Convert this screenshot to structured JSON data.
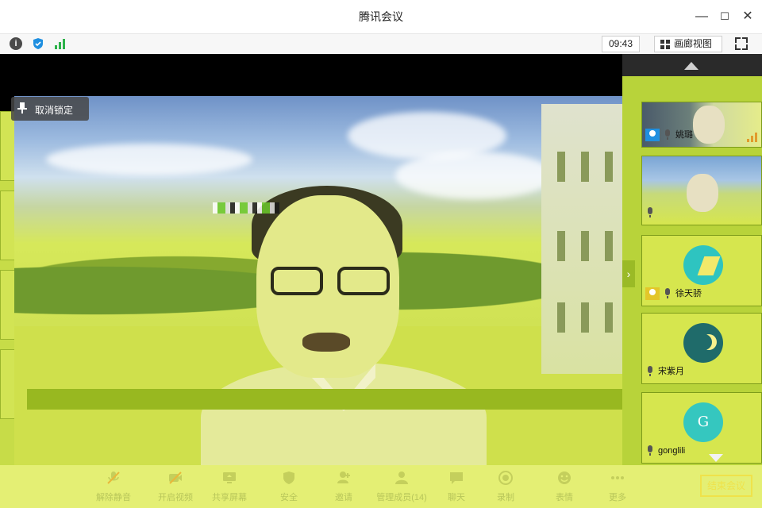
{
  "window": {
    "title": "腾讯会议",
    "minimize_glyph": "—",
    "maximize_glyph": "☐",
    "close_glyph": "✕"
  },
  "toolbar": {
    "info_icon": "info-icon",
    "info_glyph": "i",
    "shield_icon": "shield-icon",
    "signal_icon": "signal-icon",
    "time": "09:43",
    "gallery_label": "画廊视图",
    "fullscreen_icon": "fullscreen-icon"
  },
  "main_video": {
    "unlock_label": "取消锁定"
  },
  "participants": [
    {
      "name": "姚璐",
      "type": "video"
    },
    {
      "name": "",
      "type": "video"
    },
    {
      "name": "徐天骄",
      "type": "avatar"
    },
    {
      "name": "宋紫月",
      "type": "avatar"
    },
    {
      "name": "gonglili",
      "type": "avatar",
      "avatar_letter": "G"
    }
  ],
  "panel": {
    "expand_glyph": "›"
  },
  "controls": {
    "items": [
      {
        "label": "解除静音",
        "icon": "mic-off-icon"
      },
      {
        "label": "开启视频",
        "icon": "camera-off-icon"
      },
      {
        "label": "共享屏幕",
        "icon": "share-screen-icon"
      },
      {
        "label": "安全",
        "icon": "shield-icon"
      },
      {
        "label": "邀请",
        "icon": "invite-icon"
      },
      {
        "label": "管理成员(14)",
        "icon": "members-icon"
      },
      {
        "label": "聊天",
        "icon": "chat-icon"
      },
      {
        "label": "录制",
        "icon": "record-icon"
      },
      {
        "label": "表情",
        "icon": "emoji-icon"
      },
      {
        "label": "更多",
        "icon": "more-icon"
      }
    ],
    "end_label": "结束会议"
  },
  "colors": {
    "accent": "#1f8fe0",
    "signal_green": "#2db34a",
    "overlay_yellow": "#d6e64e"
  }
}
